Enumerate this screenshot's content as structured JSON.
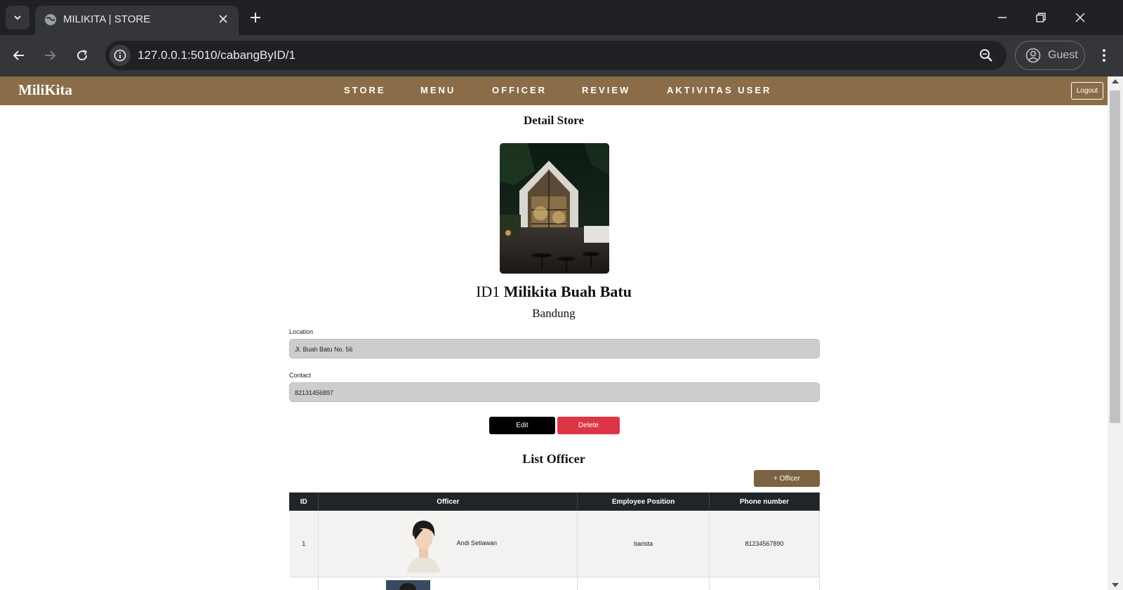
{
  "browser": {
    "tab_title": "MILIKITA | STORE",
    "url": "127.0.0.1:5010/cabangByID/1",
    "profile_label": "Guest"
  },
  "nav": {
    "brand": "MiliKita",
    "items": [
      "STORE",
      "MENU",
      "OFFICER",
      "REVIEW",
      "AKTIVITAS USER"
    ],
    "logout_label": "Logout"
  },
  "detail": {
    "heading": "Detail Store",
    "id_label": "ID1",
    "store_name": "Milikita Buah Batu",
    "city": "Bandung",
    "location_label": "Location",
    "location_value": "Jl. Buah Batu No. 56",
    "contact_label": "Contact",
    "contact_value": "82131456897",
    "edit_label": "Edit",
    "delete_label": "Delete"
  },
  "officers": {
    "heading": "List Officer",
    "add_label": "+ Officer",
    "columns": [
      "ID",
      "Officer",
      "Employee Position",
      "Phone number"
    ],
    "rows": [
      {
        "id": "1",
        "name": "Andi Setiawan",
        "position": "barista",
        "phone": "81234567890"
      }
    ]
  },
  "colors": {
    "nav_brown": "#8a6d48",
    "add_button": "#7a6242",
    "delete_red": "#dc3545",
    "table_header": "#212529"
  }
}
